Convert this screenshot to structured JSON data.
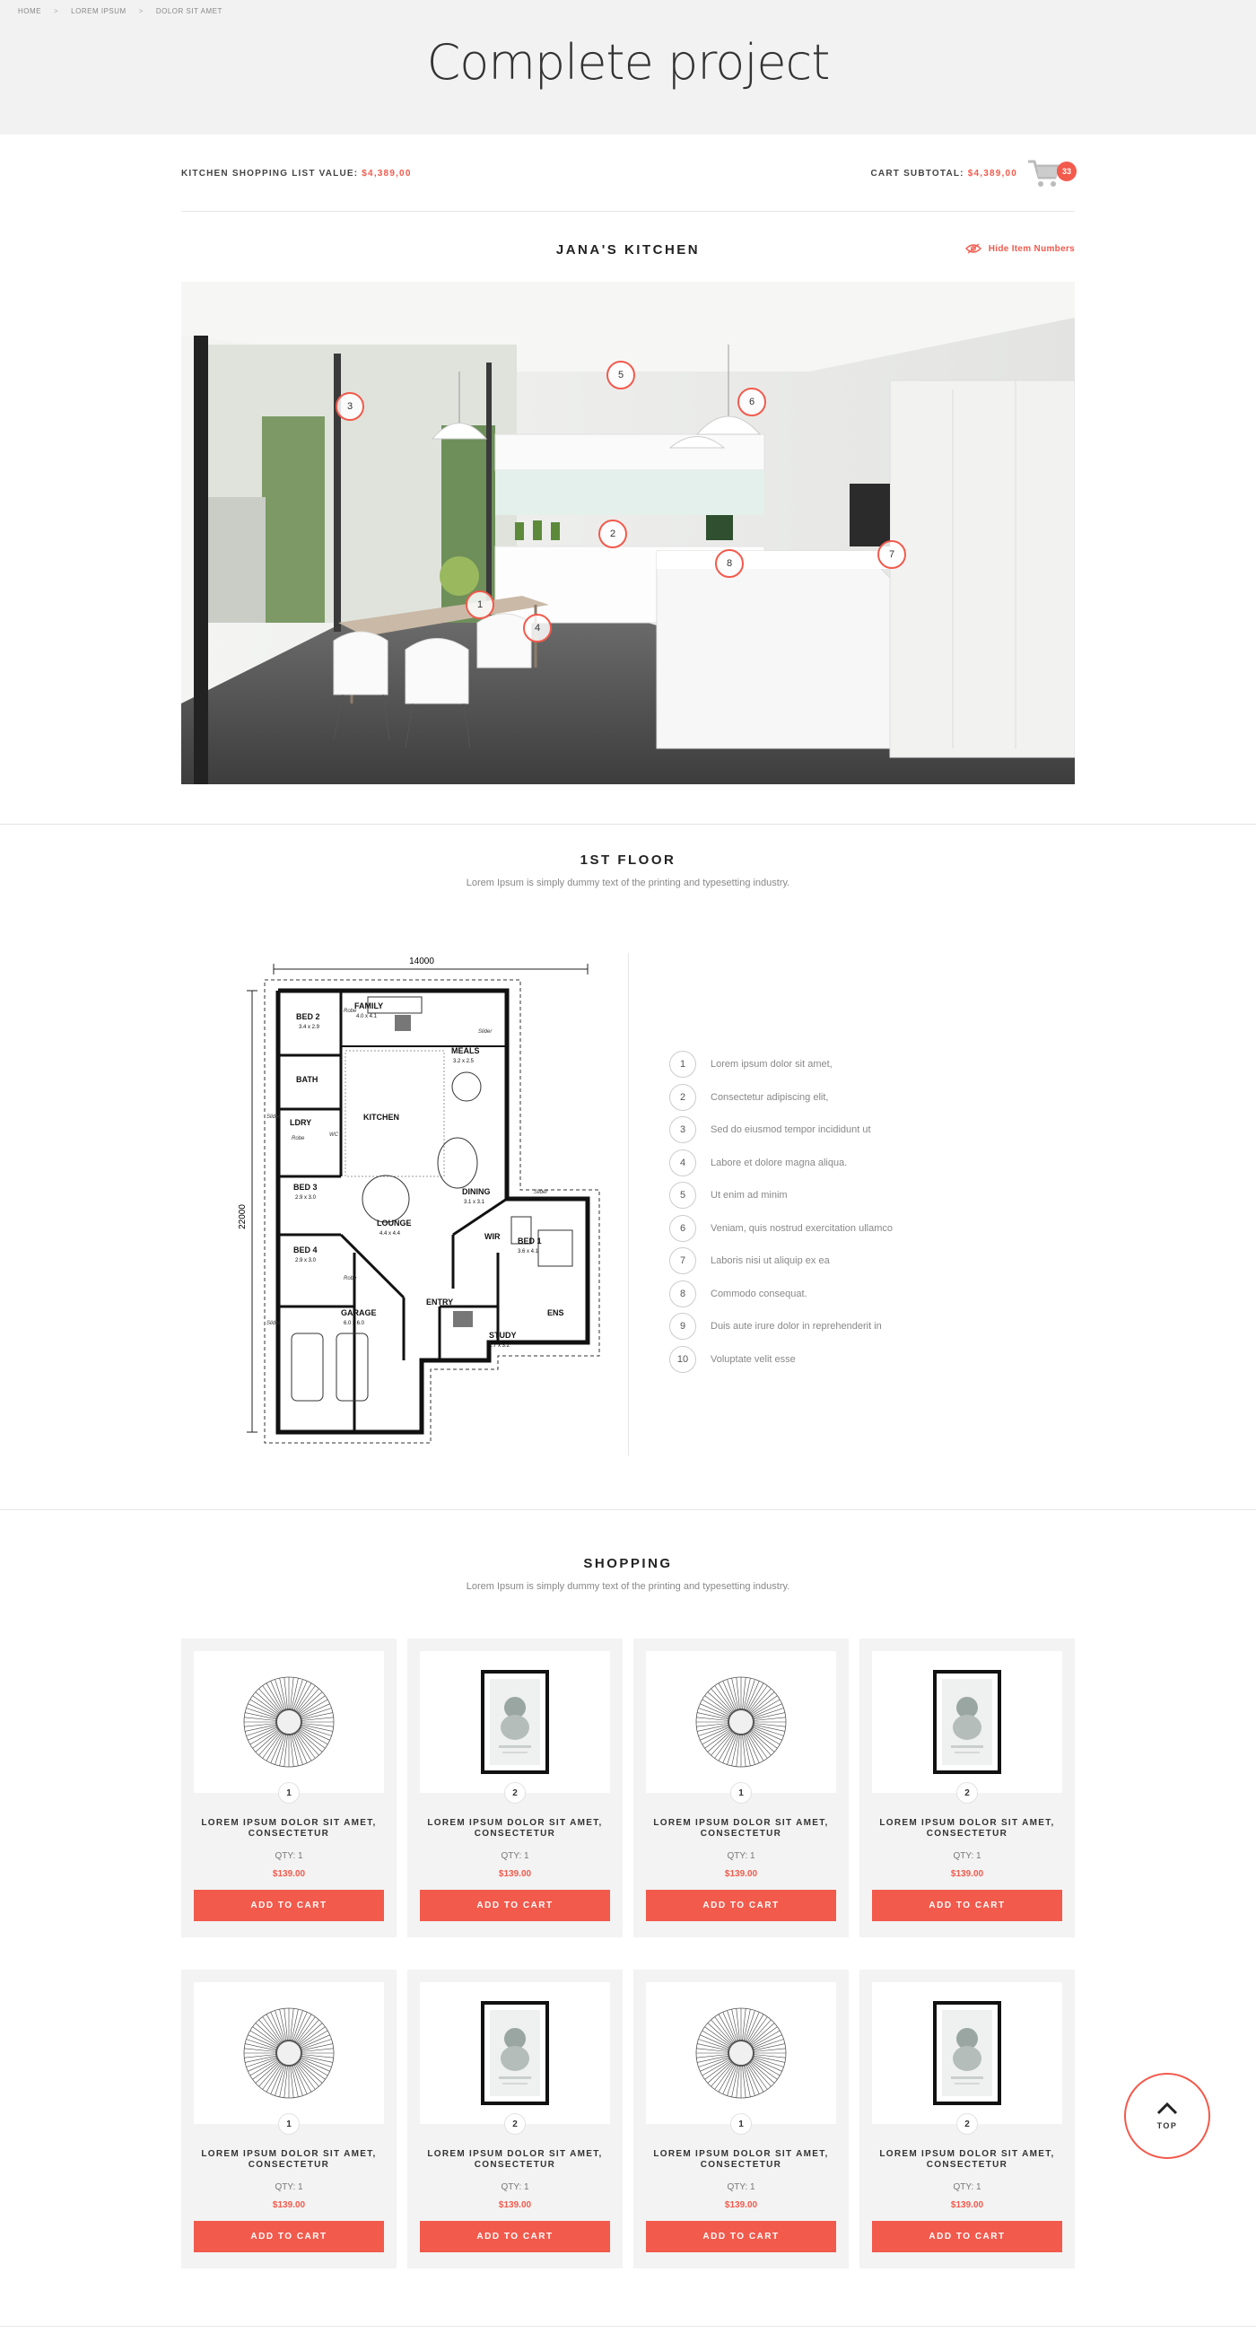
{
  "breadcrumb": [
    "HOME",
    "LOREM IPSUM",
    "DOLOR SIT AMET"
  ],
  "breadcrumb_separator": ">",
  "page_title": "Complete project",
  "summary": {
    "shopping_label": "KITCHEN SHOPPING LIST VALUE:",
    "shopping_value": "$4,389,00",
    "cart_label": "CART SUBTOTAL:",
    "cart_value": "$4,389,00",
    "cart_count": "33"
  },
  "kitchen": {
    "title": "JANA'S KITCHEN",
    "hide_label": "Hide Item Numbers",
    "hotspots": [
      "1",
      "2",
      "3",
      "4",
      "5",
      "6",
      "7",
      "8"
    ]
  },
  "floor": {
    "title": "1ST FLOOR",
    "subtitle": "Lorem Ipsum is simply dummy text of the printing and typesetting industry.",
    "plan_labels": {
      "width": "14000",
      "height": "22000",
      "rooms": [
        "BED 2",
        "3.4 x 2.9",
        "FAMILY",
        "4.0 x 4.1",
        "BATH",
        "MEALS",
        "3.2 x 2.5",
        "LDRY",
        "KITCHEN",
        "BED 3",
        "2.9 x 3.0",
        "DINING",
        "3.1 x 3.1",
        "LOUNGE",
        "4.4 x 4.4",
        "BED 4",
        "2.9 x 3.0",
        "WIR",
        "BED 1",
        "3.6 x 4.1",
        "ENTRY",
        "GARAGE",
        "6.0 x 6.0",
        "STUDY",
        "2.7 x 3.2",
        "ENS",
        "Robe",
        "Robe",
        "Robe",
        "Slider",
        "Slider",
        "Slider",
        "Slider",
        "WC"
      ]
    },
    "legend": [
      {
        "num": "1",
        "text": "Lorem ipsum dolor sit amet,"
      },
      {
        "num": "2",
        "text": "Consectetur adipiscing elit,"
      },
      {
        "num": "3",
        "text": "Sed do eiusmod tempor incididunt ut"
      },
      {
        "num": "4",
        "text": "Labore et dolore magna aliqua."
      },
      {
        "num": "5",
        "text": "Ut enim ad minim"
      },
      {
        "num": "6",
        "text": "Veniam, quis nostrud exercitation ullamco"
      },
      {
        "num": "7",
        "text": "Laboris nisi ut aliquip ex ea"
      },
      {
        "num": "8",
        "text": "Commodo consequat."
      },
      {
        "num": "9",
        "text": "Duis aute irure dolor in reprehenderit in"
      },
      {
        "num": "10",
        "text": "Voluptate velit esse"
      }
    ]
  },
  "shopping": {
    "title": "SHOPPING",
    "subtitle": "Lorem Ipsum is simply dummy text of the printing and typesetting industry.",
    "products": [
      {
        "pin": "1",
        "image": "round-mirror",
        "name": "LOREM IPSUM DOLOR SIT AMET, CONSECTETUR",
        "qty": "QTY: 1",
        "price": "$139.00",
        "button": "ADD TO CART"
      },
      {
        "pin": "2",
        "image": "framed-print",
        "name": "LOREM IPSUM DOLOR SIT AMET, CONSECTETUR",
        "qty": "QTY: 1",
        "price": "$139.00",
        "button": "ADD TO CART"
      },
      {
        "pin": "1",
        "image": "round-mirror",
        "name": "LOREM IPSUM DOLOR SIT AMET, CONSECTETUR",
        "qty": "QTY: 1",
        "price": "$139.00",
        "button": "ADD TO CART"
      },
      {
        "pin": "2",
        "image": "framed-print",
        "name": "LOREM IPSUM DOLOR SIT AMET, CONSECTETUR",
        "qty": "QTY: 1",
        "price": "$139.00",
        "button": "ADD TO CART"
      },
      {
        "pin": "1",
        "image": "round-mirror",
        "name": "LOREM IPSUM DOLOR SIT AMET, CONSECTETUR",
        "qty": "QTY: 1",
        "price": "$139.00",
        "button": "ADD TO CART"
      },
      {
        "pin": "2",
        "image": "framed-print",
        "name": "LOREM IPSUM DOLOR SIT AMET, CONSECTETUR",
        "qty": "QTY: 1",
        "price": "$139.00",
        "button": "ADD TO CART"
      },
      {
        "pin": "1",
        "image": "round-mirror",
        "name": "LOREM IPSUM DOLOR SIT AMET, CONSECTETUR",
        "qty": "QTY: 1",
        "price": "$139.00",
        "button": "ADD TO CART"
      },
      {
        "pin": "2",
        "image": "framed-print",
        "name": "LOREM IPSUM DOLOR SIT AMET, CONSECTETUR",
        "qty": "QTY: 1",
        "price": "$139.00",
        "button": "ADD TO CART"
      }
    ]
  },
  "top_button": "TOP",
  "colors": {
    "accent": "#f25a4c",
    "band": "#f2f2f2",
    "card": "#f3f3f3"
  }
}
